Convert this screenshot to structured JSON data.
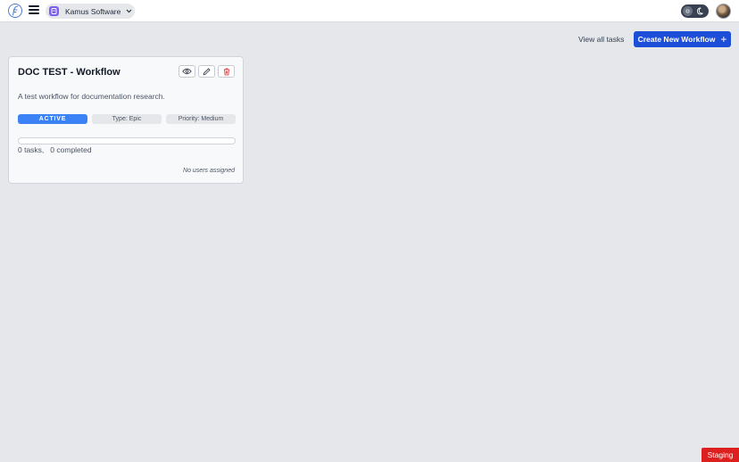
{
  "header": {
    "logo_icon": "feather-logo-icon",
    "menu_icon": "hamburger-menu-icon",
    "organization": {
      "name": "Kamus Software",
      "icon": "org-badge-icon",
      "accent": "#7c5cf2"
    },
    "theme_toggle": {
      "light_icon": "sun-icon",
      "dark_icon": "moon-icon"
    },
    "avatar": "user-avatar"
  },
  "toolbar": {
    "view_all_label": "View all tasks",
    "create_label": "Create New Workflow",
    "create_icon": "plus-icon",
    "create_color": "#1d4ed8"
  },
  "workflow_card": {
    "title": "DOC TEST - Workflow",
    "actions": [
      "eye-icon",
      "pencil-icon",
      "trash-icon"
    ],
    "description": "A test workflow for documentation research.",
    "status": "ACTIVE",
    "status_color": "#3b82f6",
    "type": "Type: Epic",
    "priority": "Priority: Medium",
    "progress": 0,
    "tasks_label": "0 tasks,",
    "completed_label": "0 completed",
    "users_label": "No users assigned"
  },
  "environment_badge": {
    "label": "Staging",
    "color": "#dc1f1f"
  }
}
